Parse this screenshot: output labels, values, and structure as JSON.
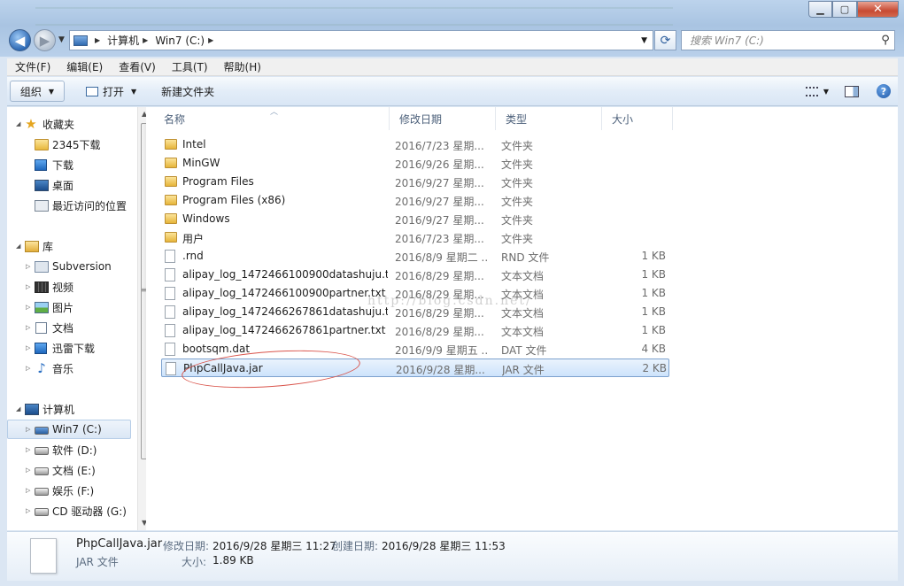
{
  "window": {
    "min_icon": "minimize-icon",
    "max_icon": "maximize-icon",
    "close_icon": "close-icon",
    "min_glyph": "▁",
    "max_glyph": "▢",
    "close_glyph": "✕"
  },
  "address": {
    "crumbs": [
      "计算机",
      "Win7 (C:)"
    ],
    "search_placeholder": "搜索 Win7 (C:)"
  },
  "menu": [
    "文件(F)",
    "编辑(E)",
    "查看(V)",
    "工具(T)",
    "帮助(H)"
  ],
  "toolbar": {
    "organize": "组织",
    "open": "打开",
    "new_folder": "新建文件夹"
  },
  "nav": {
    "favorites": {
      "label": "收藏夹",
      "items": [
        "2345下载",
        "下载",
        "桌面",
        "最近访问的位置"
      ]
    },
    "libraries": {
      "label": "库",
      "items": [
        "Subversion",
        "视频",
        "图片",
        "文档",
        "迅雷下载",
        "音乐"
      ]
    },
    "computer": {
      "label": "计算机",
      "items": [
        "Win7 (C:)",
        "软件 (D:)",
        "文档 (E:)",
        "娱乐 (F:)",
        "CD 驱动器 (G:)"
      ]
    }
  },
  "columns": [
    "名称",
    "修改日期",
    "类型",
    "大小"
  ],
  "files": [
    {
      "name": "Intel",
      "date": "2016/7/23 星期...",
      "type": "文件夹",
      "size": "",
      "kind": "folder"
    },
    {
      "name": "MinGW",
      "date": "2016/9/26 星期...",
      "type": "文件夹",
      "size": "",
      "kind": "folder"
    },
    {
      "name": "Program Files",
      "date": "2016/9/27 星期...",
      "type": "文件夹",
      "size": "",
      "kind": "folder"
    },
    {
      "name": "Program Files (x86)",
      "date": "2016/9/27 星期...",
      "type": "文件夹",
      "size": "",
      "kind": "folder"
    },
    {
      "name": "Windows",
      "date": "2016/9/27 星期...",
      "type": "文件夹",
      "size": "",
      "kind": "folder"
    },
    {
      "name": "用户",
      "date": "2016/7/23 星期...",
      "type": "文件夹",
      "size": "",
      "kind": "folder"
    },
    {
      "name": ".rnd",
      "date": "2016/8/9 星期二 ...",
      "type": "RND 文件",
      "size": "1 KB",
      "kind": "file"
    },
    {
      "name": "alipay_log_1472466100900datashuju.t...",
      "date": "2016/8/29 星期...",
      "type": "文本文档",
      "size": "1 KB",
      "kind": "file"
    },
    {
      "name": "alipay_log_1472466100900partner.txt",
      "date": "2016/8/29 星期...",
      "type": "文本文档",
      "size": "1 KB",
      "kind": "file"
    },
    {
      "name": "alipay_log_1472466267861datashuju.t...",
      "date": "2016/8/29 星期...",
      "type": "文本文档",
      "size": "1 KB",
      "kind": "file"
    },
    {
      "name": "alipay_log_1472466267861partner.txt",
      "date": "2016/8/29 星期...",
      "type": "文本文档",
      "size": "1 KB",
      "kind": "file"
    },
    {
      "name": "bootsqm.dat",
      "date": "2016/9/9 星期五 ...",
      "type": "DAT 文件",
      "size": "4 KB",
      "kind": "file"
    },
    {
      "name": "PhpCallJava.jar",
      "date": "2016/9/28 星期...",
      "type": "JAR 文件",
      "size": "2 KB",
      "kind": "file",
      "selected": true
    }
  ],
  "watermark": "http://blog.csdn.net/",
  "details": {
    "name": "PhpCallJava.jar",
    "type": "JAR 文件",
    "modified_label": "修改日期:",
    "modified_value": "2016/9/28 星期三 11:27",
    "created_label": "创建日期:",
    "created_value": "2016/9/28 星期三 11:53",
    "size_label": "大小:",
    "size_value": "1.89 KB"
  }
}
